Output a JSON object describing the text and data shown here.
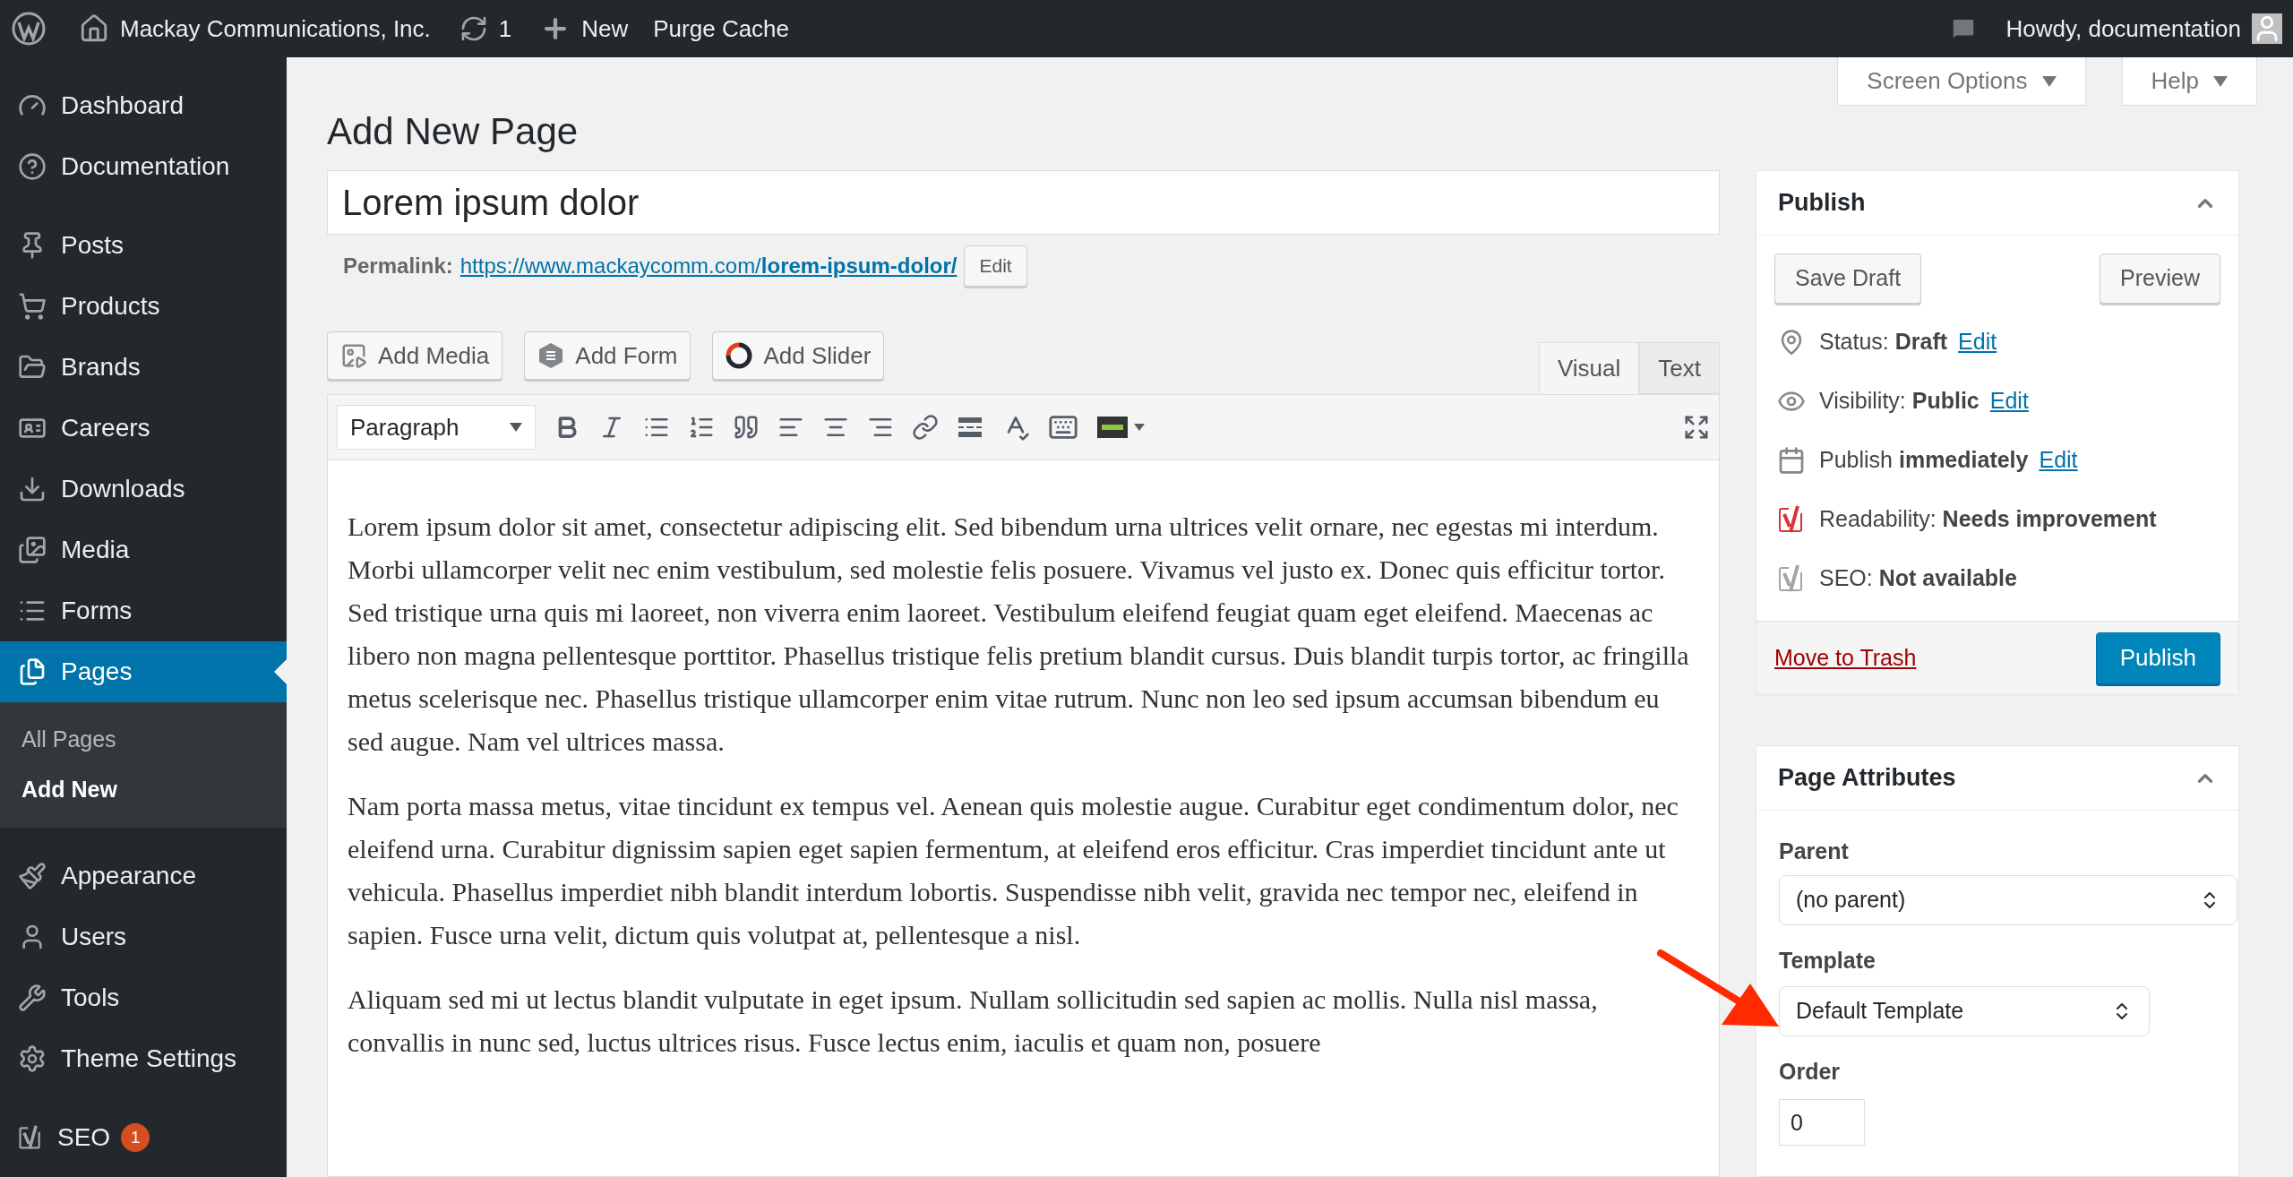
{
  "admin_bar": {
    "site_name": "Mackay Communications, Inc.",
    "updates_count": "1",
    "new_label": "New",
    "purge_label": "Purge Cache",
    "greeting": "Howdy, documentation"
  },
  "sidebar": {
    "groups": [
      [
        {
          "label": "Dashboard",
          "selected": false
        },
        {
          "label": "Documentation",
          "selected": false
        }
      ],
      [
        {
          "label": "Posts",
          "selected": false
        },
        {
          "label": "Products",
          "selected": false
        },
        {
          "label": "Brands",
          "selected": false
        },
        {
          "label": "Careers",
          "selected": false
        },
        {
          "label": "Downloads",
          "selected": false
        },
        {
          "label": "Media",
          "selected": false
        },
        {
          "label": "Forms",
          "selected": false
        },
        {
          "label": "Pages",
          "selected": true,
          "children": [
            {
              "label": "All Pages",
              "selected": false
            },
            {
              "label": "Add New",
              "selected": true
            }
          ]
        }
      ],
      [
        {
          "label": "Appearance",
          "selected": false
        },
        {
          "label": "Users",
          "selected": false
        },
        {
          "label": "Tools",
          "selected": false
        },
        {
          "label": "Theme Settings",
          "selected": false
        }
      ],
      [
        {
          "label": "SEO",
          "selected": false,
          "badge": "1"
        }
      ]
    ]
  },
  "screen_meta": [
    "Screen Options",
    "Help"
  ],
  "page_title": "Add New Page",
  "title_field": {
    "value": "Lorem ipsum dolor"
  },
  "permalink": {
    "label": "Permalink:",
    "url": "https://www.mackaycomm.com/**lorem-ipsum-dolor/**",
    "button": "Edit"
  },
  "media_buttons": [
    "Add Media",
    "Add Form",
    "Add Slider"
  ],
  "editor_tabs": [
    {
      "label": "Visual",
      "selected": true
    },
    {
      "label": "Text",
      "selected": false
    }
  ],
  "format_select": "Paragraph",
  "content": [
    "Lorem ipsum dolor sit amet, consectetur adipiscing elit. Sed bibendum urna ultrices velit ornare, nec egestas mi interdum. Morbi ullamcorper velit nec enim vestibulum, sed molestie felis posuere. Vivamus vel justo ex. Donec quis efficitur tortor. Sed tristique urna quis mi laoreet, non viverra enim laoreet. Vestibulum eleifend feugiat quam eget eleifend. Maecenas ac libero non magna pellentesque porttitor. Phasellus tristique felis pretium blandit cursus. Duis blandit turpis tortor, ac fringilla metus scelerisque nec. Phasellus tristique ullamcorper enim vitae rutrum. Nunc non leo sed ipsum accumsan bibendum eu sed augue. Nam vel ultrices massa.",
    "Nam porta massa metus, vitae tincidunt ex tempus vel. Aenean quis molestie augue. Curabitur eget condimentum dolor, nec eleifend urna. Curabitur dignissim sapien eget sapien fermentum, at eleifend eros efficitur. Cras imperdiet tincidunt ante ut vehicula. Phasellus imperdiet nibh blandit interdum lobortis. Suspendisse nibh velit, gravida nec tempor nec, eleifend in sapien. Fusce urna velit, dictum quis volutpat at, pellentesque a nisl.",
    "Aliquam sed mi ut lectus blandit vulputate in eget ipsum. Nullam sollicitudin sed sapien ac mollis. Nulla nisl massa, convallis in nunc sed, luctus ultrices risus. Fusce lectus enim, iaculis et quam non, posuere"
  ],
  "publish_box": {
    "title": "Publish",
    "save_draft": "Save Draft",
    "preview": "Preview",
    "rows": [
      {
        "kind": "status",
        "text": "Status: **Draft**",
        "link": "Edit"
      },
      {
        "kind": "visibility",
        "text": "Visibility: **Public**",
        "link": "Edit"
      },
      {
        "kind": "schedule",
        "text": "Publish **immediately**",
        "link": "Edit"
      },
      {
        "kind": "readability",
        "text": "Readability: **Needs improvement**"
      },
      {
        "kind": "seo",
        "text": "SEO: **Not available**"
      }
    ],
    "trash": "Move to Trash",
    "publish": "Publish"
  },
  "page_attributes": {
    "title": "Page Attributes",
    "parent_label": "Parent",
    "parent_value": "(no parent)",
    "template_label": "Template",
    "template_value": "Default Template",
    "order_label": "Order",
    "order_value": "0"
  }
}
